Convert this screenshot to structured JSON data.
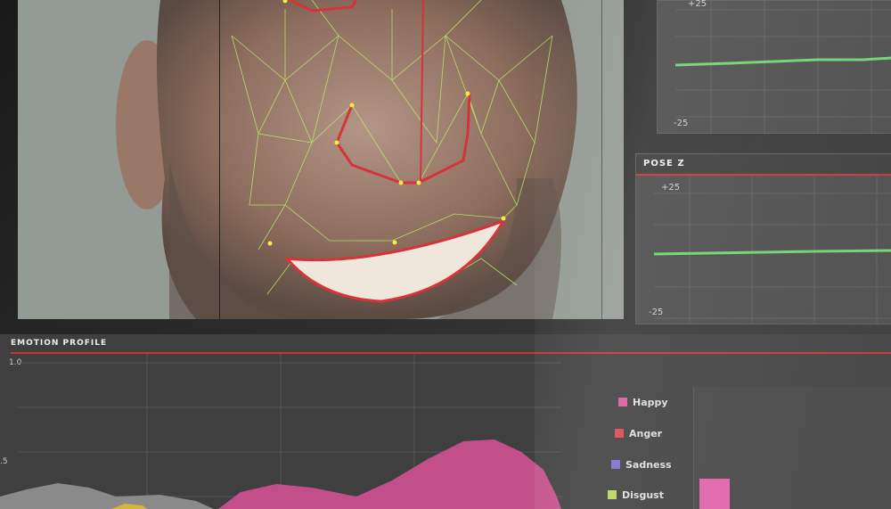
{
  "video": {
    "subject": "face-mesh-tracking"
  },
  "pose_panels": [
    {
      "title": "",
      "max_label": "+25",
      "min_label": "-25"
    },
    {
      "title": "POSE Z",
      "max_label": "+25",
      "min_label": "-25"
    }
  ],
  "emotion_profile": {
    "title": "EMOTION PROFILE",
    "y_max_label": "1.0",
    "y_mid_label": ".5",
    "legend": [
      {
        "label": "Happy",
        "color": "#d85a9a"
      },
      {
        "label": "Anger",
        "color": "#d8474a"
      },
      {
        "label": "Sadness",
        "color": "#7a6fd0"
      },
      {
        "label": "Disgust",
        "color": "#b8d65a"
      }
    ]
  },
  "colors": {
    "accent": "#c8343a",
    "mesh": "#b8f06a",
    "happy": "#c24f8a",
    "pose_line": "#6cd36c"
  }
}
